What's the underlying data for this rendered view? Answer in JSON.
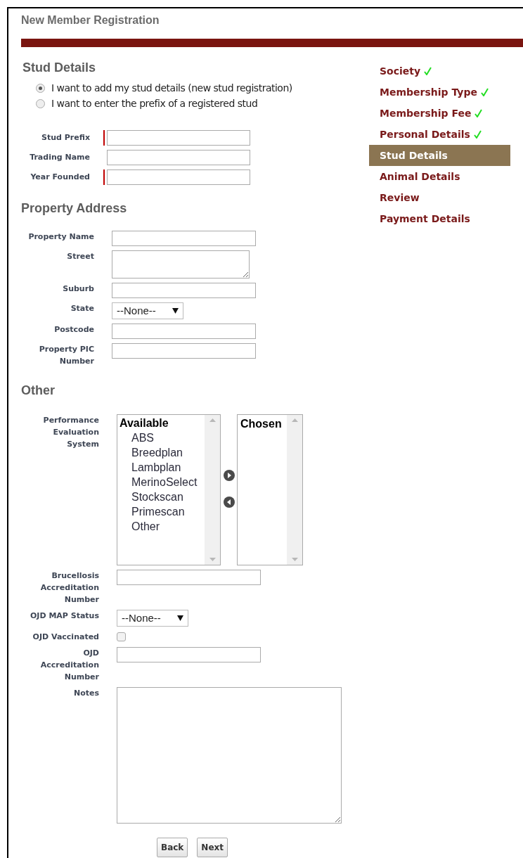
{
  "page_title": "New Member Registration",
  "steps": [
    {
      "label": "Society",
      "done": true,
      "selected": false
    },
    {
      "label": "Membership Type",
      "done": true,
      "selected": false
    },
    {
      "label": "Membership Fee",
      "done": true,
      "selected": false
    },
    {
      "label": "Personal Details",
      "done": true,
      "selected": false
    },
    {
      "label": "Stud Details",
      "done": false,
      "selected": true
    },
    {
      "label": "Animal Details",
      "done": false,
      "selected": false
    },
    {
      "label": "Review",
      "done": false,
      "selected": false
    },
    {
      "label": "Payment Details",
      "done": false,
      "selected": false
    }
  ],
  "stud_details": {
    "heading": "Stud Details",
    "options": [
      {
        "label": "I want to add my stud details (new stud registration)",
        "selected": true
      },
      {
        "label": "I want to enter the prefix of a registered stud",
        "selected": false
      }
    ],
    "fields": [
      {
        "label": "Stud Prefix",
        "kind": "text",
        "required": true
      },
      {
        "label": "Trading Name",
        "kind": "text",
        "required": false
      },
      {
        "label": "Year Founded",
        "kind": "text",
        "required": true
      }
    ]
  },
  "property_address": {
    "heading": "Property Address",
    "fields": [
      {
        "label": "Property Name",
        "kind": "text"
      },
      {
        "label": "Street",
        "kind": "textarea"
      },
      {
        "label": "Suburb",
        "kind": "text"
      },
      {
        "label": "State",
        "kind": "select",
        "value": "--None--"
      },
      {
        "label": "Postcode",
        "kind": "text"
      },
      {
        "label": "Property PIC Number",
        "kind": "text"
      }
    ]
  },
  "other": {
    "heading": "Other",
    "fields": [
      {
        "label": "Performance Evaluation System",
        "kind": "dual_list",
        "available_title": "Available",
        "available": [
          "ABS",
          "Breedplan",
          "Lambplan",
          "MerinoSelect",
          "Stockscan",
          "Primescan",
          "Other"
        ],
        "chosen_title": "Chosen"
      },
      {
        "label": "Brucellosis Accreditation Number",
        "kind": "text"
      },
      {
        "label": "OJD MAP Status",
        "kind": "select",
        "value": "--None--"
      },
      {
        "label": "OJD Vaccinated",
        "kind": "checkbox",
        "checked": false
      },
      {
        "label": "OJD Accreditation Number",
        "kind": "text"
      },
      {
        "label": "Notes",
        "kind": "notes"
      }
    ]
  },
  "buttons": [
    "Back",
    "Next"
  ]
}
